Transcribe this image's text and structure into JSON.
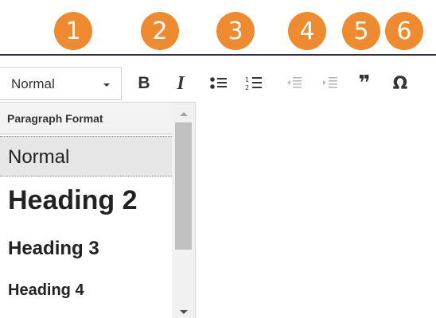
{
  "badges": [
    "1",
    "2",
    "3",
    "4",
    "5",
    "6"
  ],
  "toolbar": {
    "format_value": "Normal",
    "bold_label": "B",
    "italic_label": "I",
    "blockquote_label": "❞",
    "special_char_label": "Ω"
  },
  "dropdown": {
    "header": "Paragraph Format",
    "items": [
      {
        "label": "Normal"
      },
      {
        "label": "Heading 2"
      },
      {
        "label": "Heading 3"
      },
      {
        "label": "Heading 4"
      }
    ]
  },
  "colors": {
    "badge": "#ee8a2f",
    "toolbar_border": "#33344a",
    "selected_item": "#e6e6e6"
  }
}
